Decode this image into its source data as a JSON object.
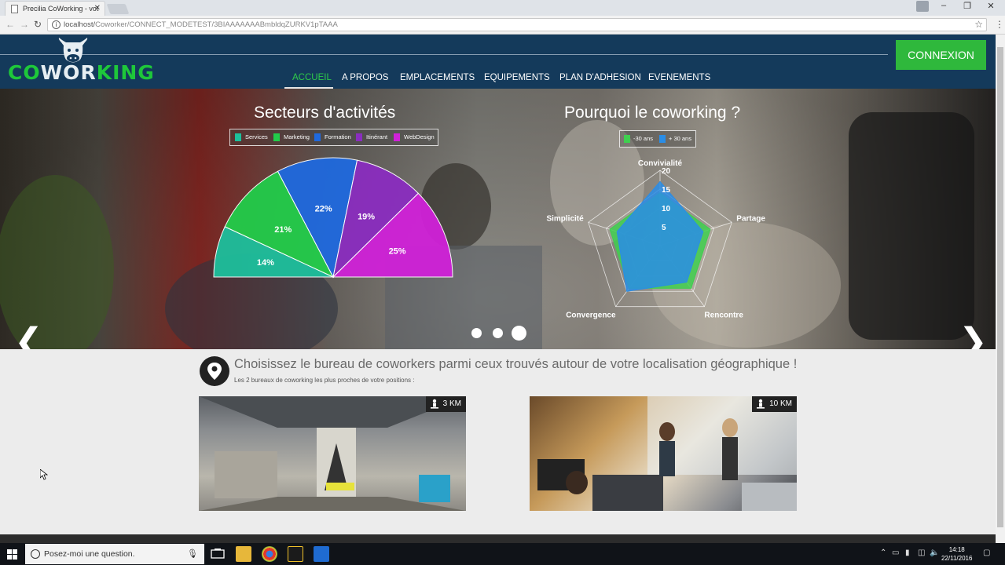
{
  "browser": {
    "tab_title": "Precilia CoWorking - vot",
    "tab_close": "✕",
    "url_prefix": "localhost/",
    "url_path": "Coworker/CONNECT_MODETEST/3BIAAAAAAABmbldqZURKV1pTAAA"
  },
  "site": {
    "logo_part1": "CO",
    "logo_part2": "WOR",
    "logo_part3": "KING",
    "nav": [
      "ACCUEIL",
      "A PROPOS",
      "EMPLACEMENTS",
      "EQUIPEMENTS",
      "PLAN D'ADHESION",
      "EVENEMENTS"
    ],
    "active_nav": "ACCUEIL",
    "login_button": "CONNEXION"
  },
  "charts": {
    "pie_title": "Secteurs d'activités",
    "radar_title": "Pourquoi le coworking ?"
  },
  "chart_data": [
    {
      "type": "pie",
      "title": "Secteurs d'activités",
      "categories": [
        "Services",
        "Marketing",
        "Formation",
        "Itinérant",
        "WebDesign"
      ],
      "values": [
        14,
        21,
        22,
        19,
        25
      ],
      "value_labels": [
        "14%",
        "21%",
        "22%",
        "19%",
        "25%"
      ],
      "colors": [
        "#1dbf9c",
        "#22cc4a",
        "#1f69de",
        "#8a2dbf",
        "#d021d8"
      ],
      "half": true,
      "legend": "top"
    },
    {
      "type": "radar",
      "title": "Pourquoi le coworking ?",
      "axes": [
        "Convivialité",
        "Partage",
        "Rencontre",
        "Convergence",
        "Simplicité"
      ],
      "ticks": [
        "5",
        "10",
        "15",
        "20"
      ],
      "max": 20,
      "series": [
        {
          "name": "-30 ans",
          "values": [
            14,
            14,
            14,
            14,
            14
          ],
          "color": "#3fcf4f"
        },
        {
          "name": "+ 30 ans",
          "values": [
            17,
            12,
            12,
            15,
            12
          ],
          "color": "#2a8de6"
        }
      ],
      "legend": "top"
    }
  ],
  "location": {
    "title": "Choisissez le bureau de coworkers parmi ceux trouvés autour de votre localisation géographique !",
    "subtitle": "Les 2 bureaux de coworking les plus proches de votre positions :",
    "offices": [
      {
        "distance": "3 KM"
      },
      {
        "distance": "10 KM"
      }
    ]
  },
  "taskbar": {
    "search_placeholder": "Posez-moi une question.",
    "time": "14:18",
    "date": "22/11/2016"
  }
}
